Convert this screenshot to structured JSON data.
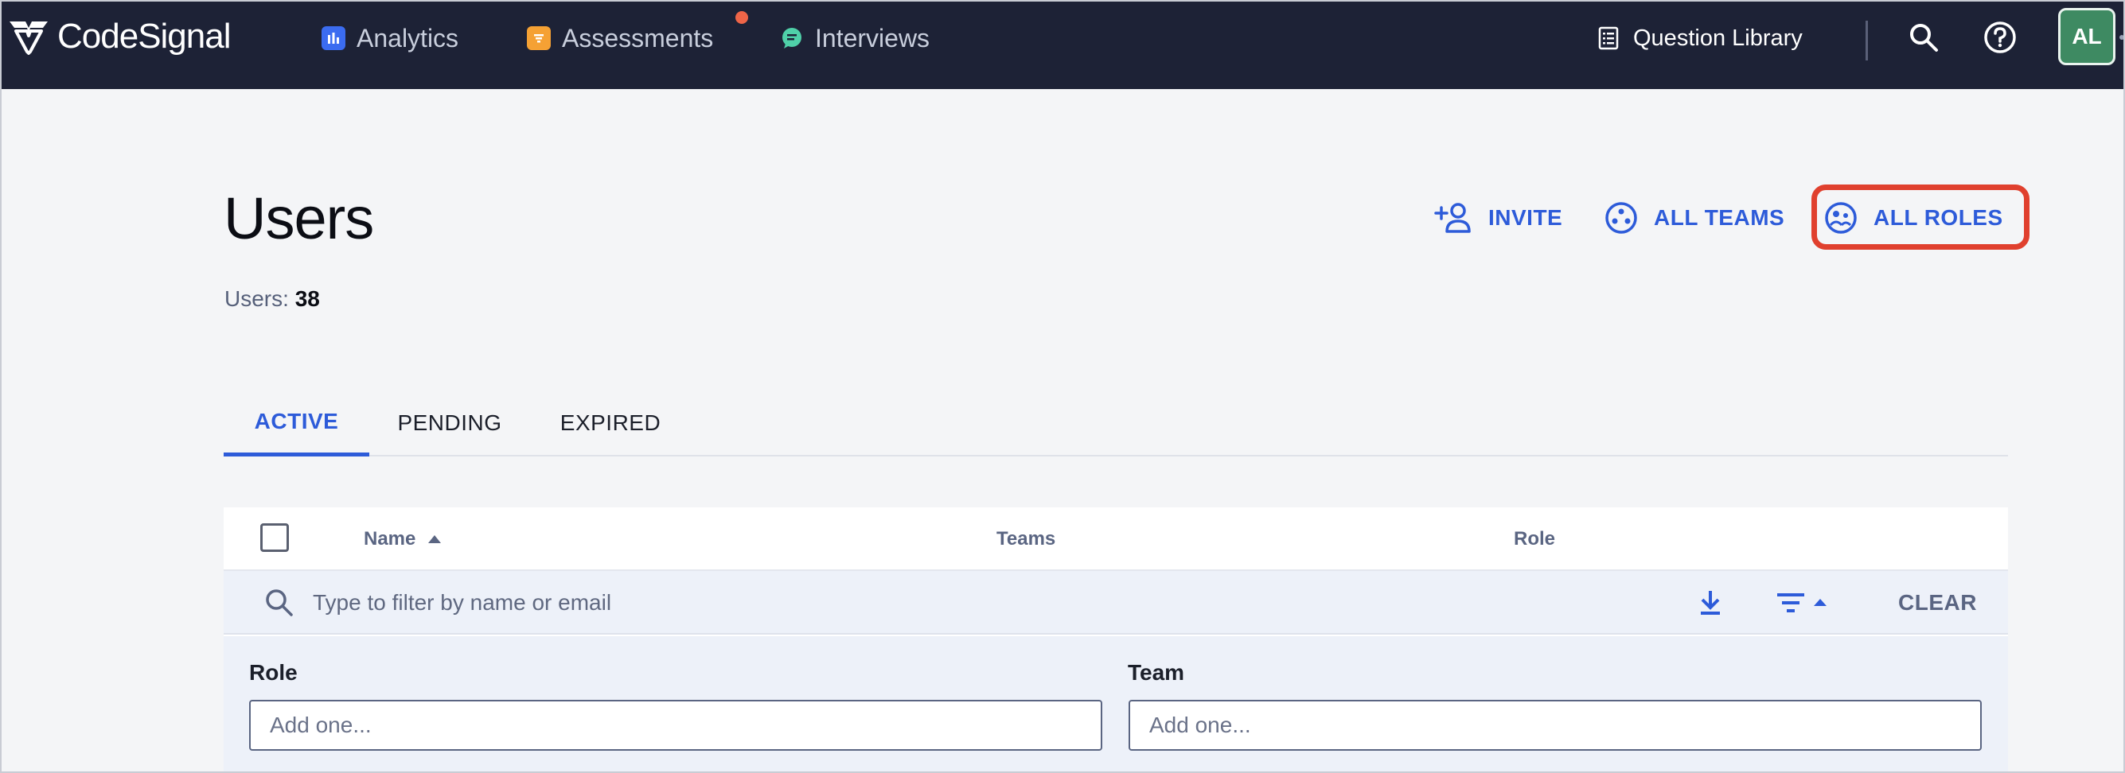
{
  "topnav": {
    "brand": "CodeSignal",
    "items": [
      {
        "label": "Analytics",
        "icon": "bar-chart-icon",
        "color": "#3b6cf0"
      },
      {
        "label": "Assessments",
        "icon": "clipboard-icon",
        "color": "#f5a134"
      },
      {
        "label": "Interviews",
        "icon": "chat-bubble-icon",
        "color": "#4fd0a8"
      }
    ],
    "question_library": "Question Library",
    "avatar_initials": "AL",
    "notification_color": "#ee6548"
  },
  "header": {
    "title": "Users",
    "count_label": "Users:",
    "count_value": "38",
    "actions": {
      "invite": "INVITE",
      "all_teams": "ALL TEAMS",
      "all_roles": "ALL ROLES"
    },
    "accent_color": "#2d5bd9",
    "highlight_color": "#e0402e"
  },
  "tabs": [
    {
      "label": "ACTIVE",
      "active": true
    },
    {
      "label": "PENDING",
      "active": false
    },
    {
      "label": "EXPIRED",
      "active": false
    }
  ],
  "table": {
    "columns": [
      "Name",
      "Teams",
      "Role"
    ],
    "sort_column": "Name",
    "sort_direction": "ascending",
    "search_placeholder": "Type to filter by name or email",
    "clear_label": "CLEAR"
  },
  "filters": {
    "role_label": "Role",
    "role_placeholder": "Add one...",
    "team_label": "Team",
    "team_placeholder": "Add one..."
  }
}
